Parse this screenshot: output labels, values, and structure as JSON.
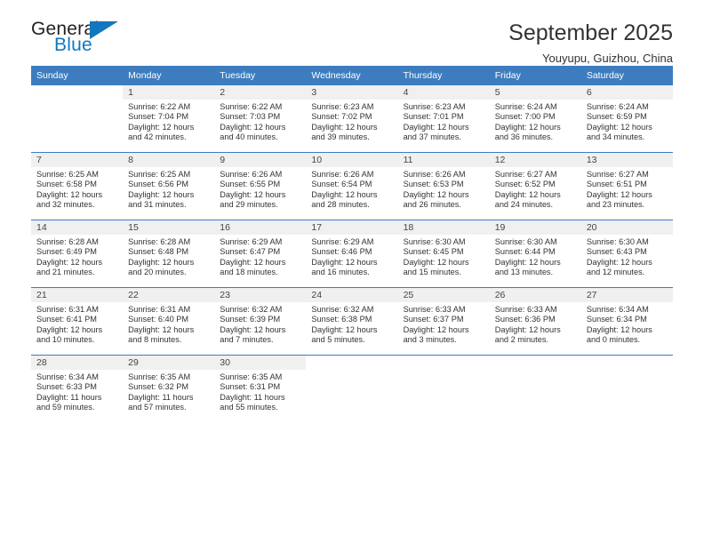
{
  "logo": {
    "word_one": "General",
    "word_two": "Blue",
    "triangle_icon": "triangle-icon",
    "accent_color": "#1277bc"
  },
  "header": {
    "title": "September 2025",
    "subtitle": "Youyupu, Guizhou, China"
  },
  "calendar": {
    "header_color": "#3d7dbf",
    "daynum_band_color": "#f0f0f0",
    "weekdays": [
      "Sunday",
      "Monday",
      "Tuesday",
      "Wednesday",
      "Thursday",
      "Friday",
      "Saturday"
    ],
    "weeks": [
      [
        {
          "day": "",
          "lines": []
        },
        {
          "day": "1",
          "lines": [
            "Sunrise: 6:22 AM",
            "Sunset: 7:04 PM",
            "Daylight: 12 hours",
            "and 42 minutes."
          ]
        },
        {
          "day": "2",
          "lines": [
            "Sunrise: 6:22 AM",
            "Sunset: 7:03 PM",
            "Daylight: 12 hours",
            "and 40 minutes."
          ]
        },
        {
          "day": "3",
          "lines": [
            "Sunrise: 6:23 AM",
            "Sunset: 7:02 PM",
            "Daylight: 12 hours",
            "and 39 minutes."
          ]
        },
        {
          "day": "4",
          "lines": [
            "Sunrise: 6:23 AM",
            "Sunset: 7:01 PM",
            "Daylight: 12 hours",
            "and 37 minutes."
          ]
        },
        {
          "day": "5",
          "lines": [
            "Sunrise: 6:24 AM",
            "Sunset: 7:00 PM",
            "Daylight: 12 hours",
            "and 36 minutes."
          ]
        },
        {
          "day": "6",
          "lines": [
            "Sunrise: 6:24 AM",
            "Sunset: 6:59 PM",
            "Daylight: 12 hours",
            "and 34 minutes."
          ]
        }
      ],
      [
        {
          "day": "7",
          "lines": [
            "Sunrise: 6:25 AM",
            "Sunset: 6:58 PM",
            "Daylight: 12 hours",
            "and 32 minutes."
          ]
        },
        {
          "day": "8",
          "lines": [
            "Sunrise: 6:25 AM",
            "Sunset: 6:56 PM",
            "Daylight: 12 hours",
            "and 31 minutes."
          ]
        },
        {
          "day": "9",
          "lines": [
            "Sunrise: 6:26 AM",
            "Sunset: 6:55 PM",
            "Daylight: 12 hours",
            "and 29 minutes."
          ]
        },
        {
          "day": "10",
          "lines": [
            "Sunrise: 6:26 AM",
            "Sunset: 6:54 PM",
            "Daylight: 12 hours",
            "and 28 minutes."
          ]
        },
        {
          "day": "11",
          "lines": [
            "Sunrise: 6:26 AM",
            "Sunset: 6:53 PM",
            "Daylight: 12 hours",
            "and 26 minutes."
          ]
        },
        {
          "day": "12",
          "lines": [
            "Sunrise: 6:27 AM",
            "Sunset: 6:52 PM",
            "Daylight: 12 hours",
            "and 24 minutes."
          ]
        },
        {
          "day": "13",
          "lines": [
            "Sunrise: 6:27 AM",
            "Sunset: 6:51 PM",
            "Daylight: 12 hours",
            "and 23 minutes."
          ]
        }
      ],
      [
        {
          "day": "14",
          "lines": [
            "Sunrise: 6:28 AM",
            "Sunset: 6:49 PM",
            "Daylight: 12 hours",
            "and 21 minutes."
          ]
        },
        {
          "day": "15",
          "lines": [
            "Sunrise: 6:28 AM",
            "Sunset: 6:48 PM",
            "Daylight: 12 hours",
            "and 20 minutes."
          ]
        },
        {
          "day": "16",
          "lines": [
            "Sunrise: 6:29 AM",
            "Sunset: 6:47 PM",
            "Daylight: 12 hours",
            "and 18 minutes."
          ]
        },
        {
          "day": "17",
          "lines": [
            "Sunrise: 6:29 AM",
            "Sunset: 6:46 PM",
            "Daylight: 12 hours",
            "and 16 minutes."
          ]
        },
        {
          "day": "18",
          "lines": [
            "Sunrise: 6:30 AM",
            "Sunset: 6:45 PM",
            "Daylight: 12 hours",
            "and 15 minutes."
          ]
        },
        {
          "day": "19",
          "lines": [
            "Sunrise: 6:30 AM",
            "Sunset: 6:44 PM",
            "Daylight: 12 hours",
            "and 13 minutes."
          ]
        },
        {
          "day": "20",
          "lines": [
            "Sunrise: 6:30 AM",
            "Sunset: 6:43 PM",
            "Daylight: 12 hours",
            "and 12 minutes."
          ]
        }
      ],
      [
        {
          "day": "21",
          "lines": [
            "Sunrise: 6:31 AM",
            "Sunset: 6:41 PM",
            "Daylight: 12 hours",
            "and 10 minutes."
          ]
        },
        {
          "day": "22",
          "lines": [
            "Sunrise: 6:31 AM",
            "Sunset: 6:40 PM",
            "Daylight: 12 hours",
            "and 8 minutes."
          ]
        },
        {
          "day": "23",
          "lines": [
            "Sunrise: 6:32 AM",
            "Sunset: 6:39 PM",
            "Daylight: 12 hours",
            "and 7 minutes."
          ]
        },
        {
          "day": "24",
          "lines": [
            "Sunrise: 6:32 AM",
            "Sunset: 6:38 PM",
            "Daylight: 12 hours",
            "and 5 minutes."
          ]
        },
        {
          "day": "25",
          "lines": [
            "Sunrise: 6:33 AM",
            "Sunset: 6:37 PM",
            "Daylight: 12 hours",
            "and 3 minutes."
          ]
        },
        {
          "day": "26",
          "lines": [
            "Sunrise: 6:33 AM",
            "Sunset: 6:36 PM",
            "Daylight: 12 hours",
            "and 2 minutes."
          ]
        },
        {
          "day": "27",
          "lines": [
            "Sunrise: 6:34 AM",
            "Sunset: 6:34 PM",
            "Daylight: 12 hours",
            "and 0 minutes."
          ]
        }
      ],
      [
        {
          "day": "28",
          "lines": [
            "Sunrise: 6:34 AM",
            "Sunset: 6:33 PM",
            "Daylight: 11 hours",
            "and 59 minutes."
          ]
        },
        {
          "day": "29",
          "lines": [
            "Sunrise: 6:35 AM",
            "Sunset: 6:32 PM",
            "Daylight: 11 hours",
            "and 57 minutes."
          ]
        },
        {
          "day": "30",
          "lines": [
            "Sunrise: 6:35 AM",
            "Sunset: 6:31 PM",
            "Daylight: 11 hours",
            "and 55 minutes."
          ]
        },
        {
          "day": "",
          "lines": []
        },
        {
          "day": "",
          "lines": []
        },
        {
          "day": "",
          "lines": []
        },
        {
          "day": "",
          "lines": []
        }
      ]
    ]
  }
}
